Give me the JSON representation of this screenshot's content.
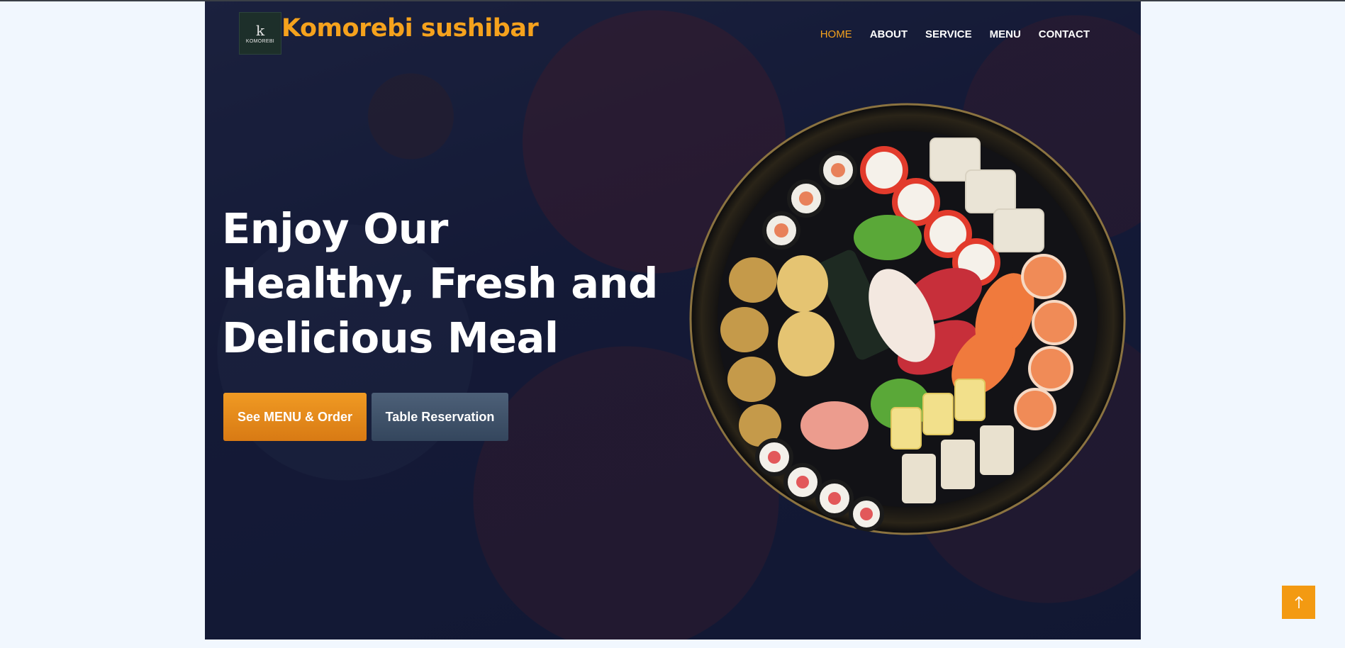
{
  "header": {
    "logo_text": "KOMOREBI",
    "brand": "Komorebi sushibar"
  },
  "nav": {
    "items": [
      {
        "label": "HOME",
        "active": true
      },
      {
        "label": "ABOUT",
        "active": false
      },
      {
        "label": "SERVICE",
        "active": false
      },
      {
        "label": "MENU",
        "active": false
      },
      {
        "label": "CONTACT",
        "active": false
      }
    ]
  },
  "hero": {
    "headline_lines": [
      "Enjoy Our",
      "Healthy, Fresh and",
      "Delicious Meal"
    ],
    "primary_button": "See MENU & Order",
    "secondary_button": "Table Reservation",
    "image": "sushi-platter"
  },
  "scroll_top": {
    "icon": "arrow-up-icon"
  },
  "colors": {
    "accent": "#f5a21d",
    "hero_bg": "#1c2240",
    "page_bg": "#f1f7fe",
    "secondary_button": "#3e5169"
  }
}
